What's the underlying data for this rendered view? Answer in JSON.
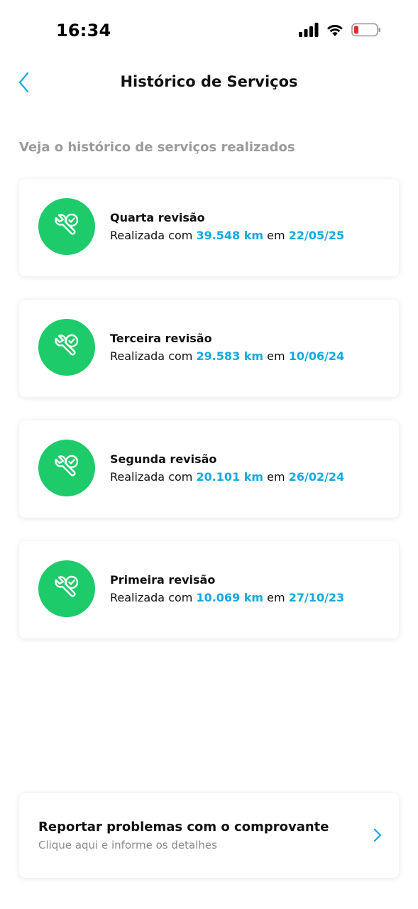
{
  "status_bar": {
    "time": "16:34"
  },
  "header": {
    "title": "Histórico de Serviços"
  },
  "subtitle": "Veja o histórico de serviços realizados",
  "services": [
    {
      "title": "Quarta revisão",
      "prefix": "Realizada com",
      "km": "39.548 km",
      "mid": "em",
      "date": "22/05/25"
    },
    {
      "title": "Terceira revisão",
      "prefix": "Realizada com",
      "km": "29.583 km",
      "mid": "em",
      "date": "10/06/24"
    },
    {
      "title": "Segunda revisão",
      "prefix": "Realizada com",
      "km": "20.101 km",
      "mid": "em",
      "date": "26/02/24"
    },
    {
      "title": "Primeira revisão",
      "prefix": "Realizada com",
      "km": "10.069 km",
      "mid": "em",
      "date": "27/10/23"
    }
  ],
  "report": {
    "title": "Reportar problemas com o comprovante",
    "subtitle": "Clique aqui e informe os detalhes"
  },
  "colors": {
    "accent": "#15a9e0",
    "success": "#1ecb6a",
    "muted": "#9b9b9b",
    "battery_low": "#e8282b"
  },
  "icons": {
    "back": "chevron-left-icon",
    "service": "wrench-check-icon",
    "report": "chevron-right-icon"
  }
}
